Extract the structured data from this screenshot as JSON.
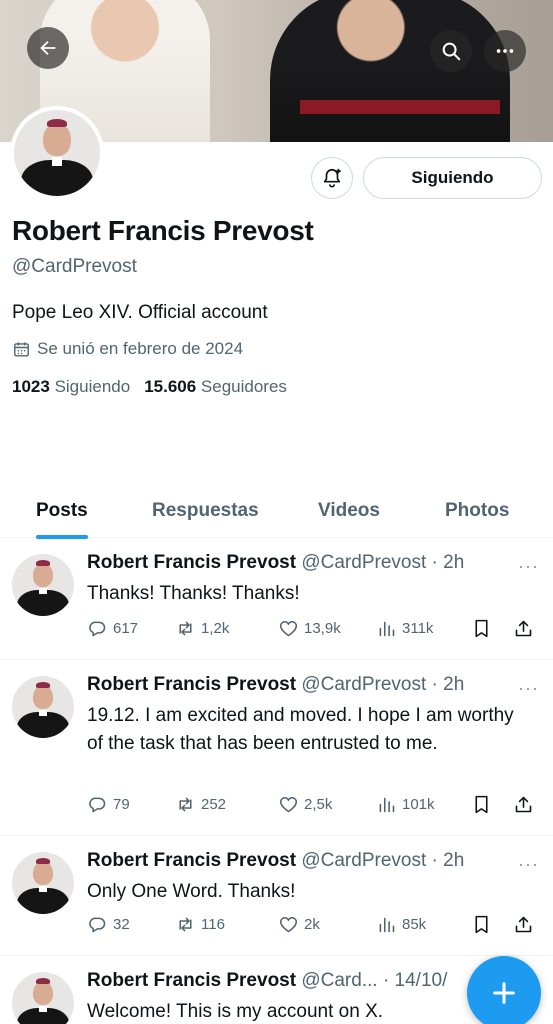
{
  "profile": {
    "name": "Robert Francis Prevost",
    "handle": "@CardPrevost",
    "bio": "Pope Leo XIV. Official account",
    "joined": "Se unió en febrero de 2024",
    "following_count": "1023",
    "following_label": "Siguiendo",
    "followers_count": "15.606",
    "followers_label": "Seguidores",
    "follow_button": "Siguiendo"
  },
  "tabs": [
    {
      "label": "Posts",
      "active": true
    },
    {
      "label": "Respuestas",
      "active": false
    },
    {
      "label": "Videos",
      "active": false
    },
    {
      "label": "Photos",
      "active": false
    }
  ],
  "posts": [
    {
      "name": "Robert Francis Prevost",
      "meta": "@CardPrevost · 2h",
      "text": "Thanks! Thanks! Thanks!",
      "replies": "617",
      "reposts": "1,2k",
      "likes": "13,9k",
      "views": "311k"
    },
    {
      "name": "Robert Francis Prevost",
      "meta": "@CardPrevost · 2h",
      "text": "19.12. I am excited and moved. I hope I am worthy of the task that has been entrusted to me.",
      "replies": "79",
      "reposts": "252",
      "likes": "2,5k",
      "views": "101k"
    },
    {
      "name": "Robert Francis Prevost",
      "meta": "@CardPrevost · 2h",
      "text": "Only One Word. Thanks!",
      "replies": "32",
      "reposts": "116",
      "likes": "2k",
      "views": "85k"
    },
    {
      "name": "Robert Francis Prevost",
      "meta": "@Card... · 14/10/",
      "text": "Welcome! This is my account on X."
    }
  ],
  "icons": {
    "back": "arrow-left-icon",
    "search": "search-icon",
    "more": "more-icon",
    "bell": "bell-plus-icon",
    "calendar": "calendar-icon",
    "reply": "reply-icon",
    "repost": "repost-icon",
    "like": "heart-icon",
    "views": "views-icon",
    "bookmark": "bookmark-icon",
    "share": "share-icon",
    "compose": "plus-icon"
  },
  "colors": {
    "accent": "#1d9bf0",
    "text": "#0f1419",
    "secondary": "#536471"
  }
}
